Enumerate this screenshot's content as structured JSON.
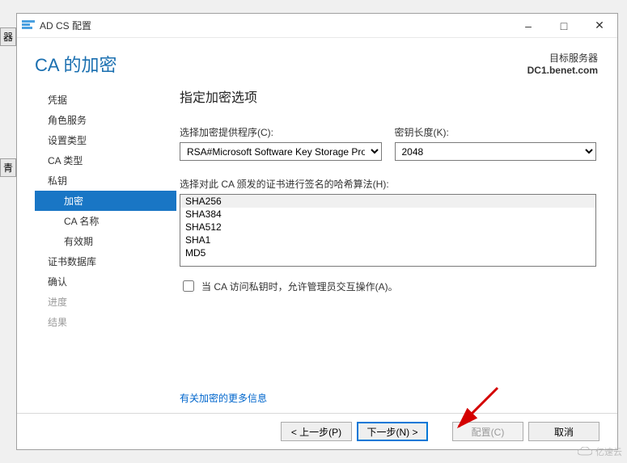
{
  "window": {
    "title": "AD CS 配置"
  },
  "header": {
    "page_title": "CA 的加密",
    "target_label": "目标服务器",
    "target_server": "DC1.benet.com"
  },
  "sidebar": {
    "items": [
      {
        "label": "凭据",
        "cls": ""
      },
      {
        "label": "角色服务",
        "cls": ""
      },
      {
        "label": "设置类型",
        "cls": ""
      },
      {
        "label": "CA 类型",
        "cls": ""
      },
      {
        "label": "私钥",
        "cls": ""
      },
      {
        "label": "加密",
        "cls": "sub active"
      },
      {
        "label": "CA 名称",
        "cls": "sub"
      },
      {
        "label": "有效期",
        "cls": "sub"
      },
      {
        "label": "证书数据库",
        "cls": ""
      },
      {
        "label": "确认",
        "cls": ""
      },
      {
        "label": "进度",
        "cls": "disabled"
      },
      {
        "label": "结果",
        "cls": "disabled"
      }
    ]
  },
  "main": {
    "section_title": "指定加密选项",
    "provider_label": "选择加密提供程序(C):",
    "provider_value": "RSA#Microsoft Software Key Storage Provider",
    "keylen_label": "密钥长度(K):",
    "keylen_value": "2048",
    "hash_label": "选择对此 CA 颁发的证书进行签名的哈希算法(H):",
    "hash_items": [
      "SHA256",
      "SHA384",
      "SHA512",
      "SHA1",
      "MD5"
    ],
    "hash_selected": 0,
    "interact_label": "当 CA 访问私钥时，允许管理员交互操作(A)。",
    "more_link": "有关加密的更多信息"
  },
  "footer": {
    "prev": "< 上一步(P)",
    "next": "下一步(N) >",
    "configure": "配置(C)",
    "cancel": "取消"
  },
  "edge_tabs": {
    "top": "器",
    "bottom": "青"
  },
  "watermark": "亿速云"
}
